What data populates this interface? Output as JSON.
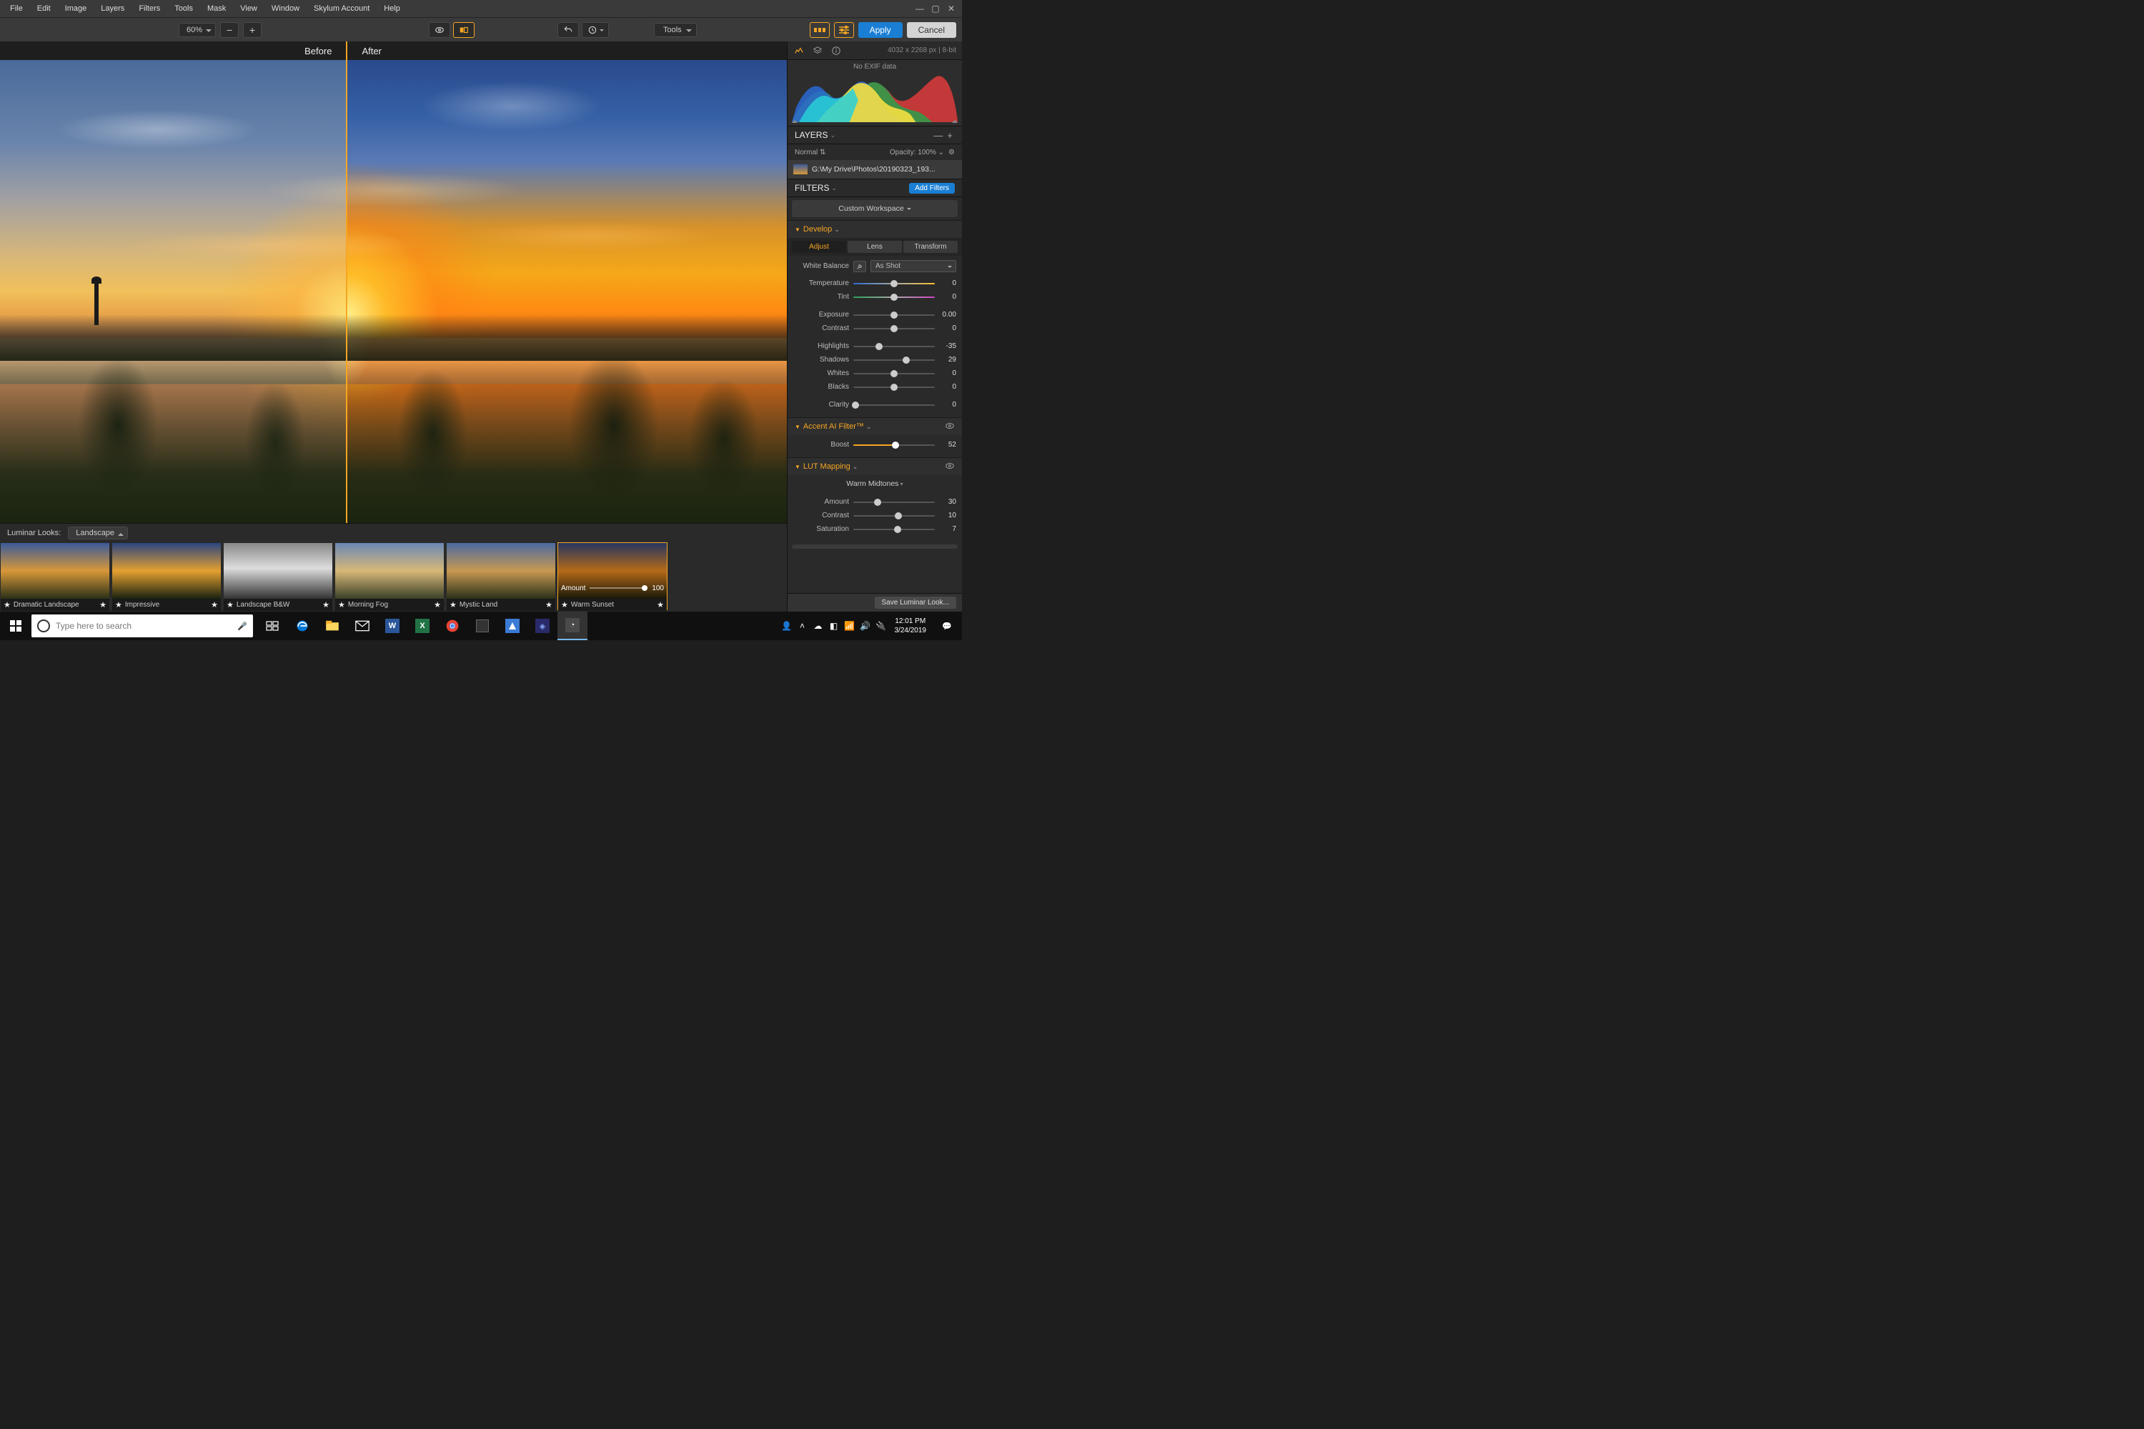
{
  "menu": {
    "items": [
      "File",
      "Edit",
      "Image",
      "Layers",
      "Filters",
      "Tools",
      "Mask",
      "View",
      "Window",
      "Skylum Account",
      "Help"
    ]
  },
  "toolbar": {
    "zoom": "60%",
    "tools_label": "Tools",
    "apply": "Apply",
    "cancel": "Cancel"
  },
  "compare": {
    "before": "Before",
    "after": "After"
  },
  "panel": {
    "dims": "4032 x 2268 px  |  8-bit",
    "noexif": "No EXIF data",
    "layers_title": "LAYERS",
    "blend_mode": "Normal",
    "opacity": "Opacity: 100%",
    "layer_path": "G:\\My Drive\\Photos\\20190323_193...",
    "filters_title": "FILTERS",
    "add_filters": "Add Filters",
    "workspace": "Custom Workspace",
    "develop": {
      "title": "Develop",
      "tabs": [
        "Adjust",
        "Lens",
        "Transform"
      ],
      "wb_label": "White Balance",
      "wb_value": "As Shot",
      "sliders": [
        {
          "label": "Temperature",
          "value": "0",
          "pos": 50,
          "cls": "temp"
        },
        {
          "label": "Tint",
          "value": "0",
          "pos": 50,
          "cls": "tint"
        },
        {
          "label": "Exposure",
          "value": "0.00",
          "pos": 50,
          "gap": true
        },
        {
          "label": "Contrast",
          "value": "0",
          "pos": 50
        },
        {
          "label": "Highlights",
          "value": "-35",
          "pos": 32,
          "gap": true
        },
        {
          "label": "Shadows",
          "value": "29",
          "pos": 65
        },
        {
          "label": "Whites",
          "value": "0",
          "pos": 50
        },
        {
          "label": "Blacks",
          "value": "0",
          "pos": 50
        },
        {
          "label": "Clarity",
          "value": "0",
          "pos": 3,
          "gap": true
        }
      ]
    },
    "accent": {
      "title": "Accent AI Filter™",
      "label": "Boost",
      "value": "52",
      "pos": 52
    },
    "lut": {
      "title": "LUT Mapping",
      "preset": "Warm Midtones",
      "sliders": [
        {
          "label": "Amount",
          "value": "30",
          "pos": 30
        },
        {
          "label": "Contrast",
          "value": "10",
          "pos": 55
        },
        {
          "label": "Saturation",
          "value": "7",
          "pos": 54
        }
      ]
    },
    "save_look": "Save Luminar Look..."
  },
  "looks": {
    "title": "Luminar Looks:",
    "category": "Landscape",
    "items": [
      {
        "name": "Dramatic Landscape",
        "cls": "t1"
      },
      {
        "name": "Impressive",
        "cls": "t2"
      },
      {
        "name": "Landscape B&W",
        "cls": "t3"
      },
      {
        "name": "Morning Fog",
        "cls": "t4"
      },
      {
        "name": "Mystic Land",
        "cls": "t5"
      },
      {
        "name": "Warm Sunset",
        "cls": "t6",
        "selected": true,
        "amount_label": "Amount",
        "amount_value": "100"
      }
    ]
  },
  "taskbar": {
    "search_placeholder": "Type here to search",
    "time": "12:01 PM",
    "date": "3/24/2019"
  }
}
